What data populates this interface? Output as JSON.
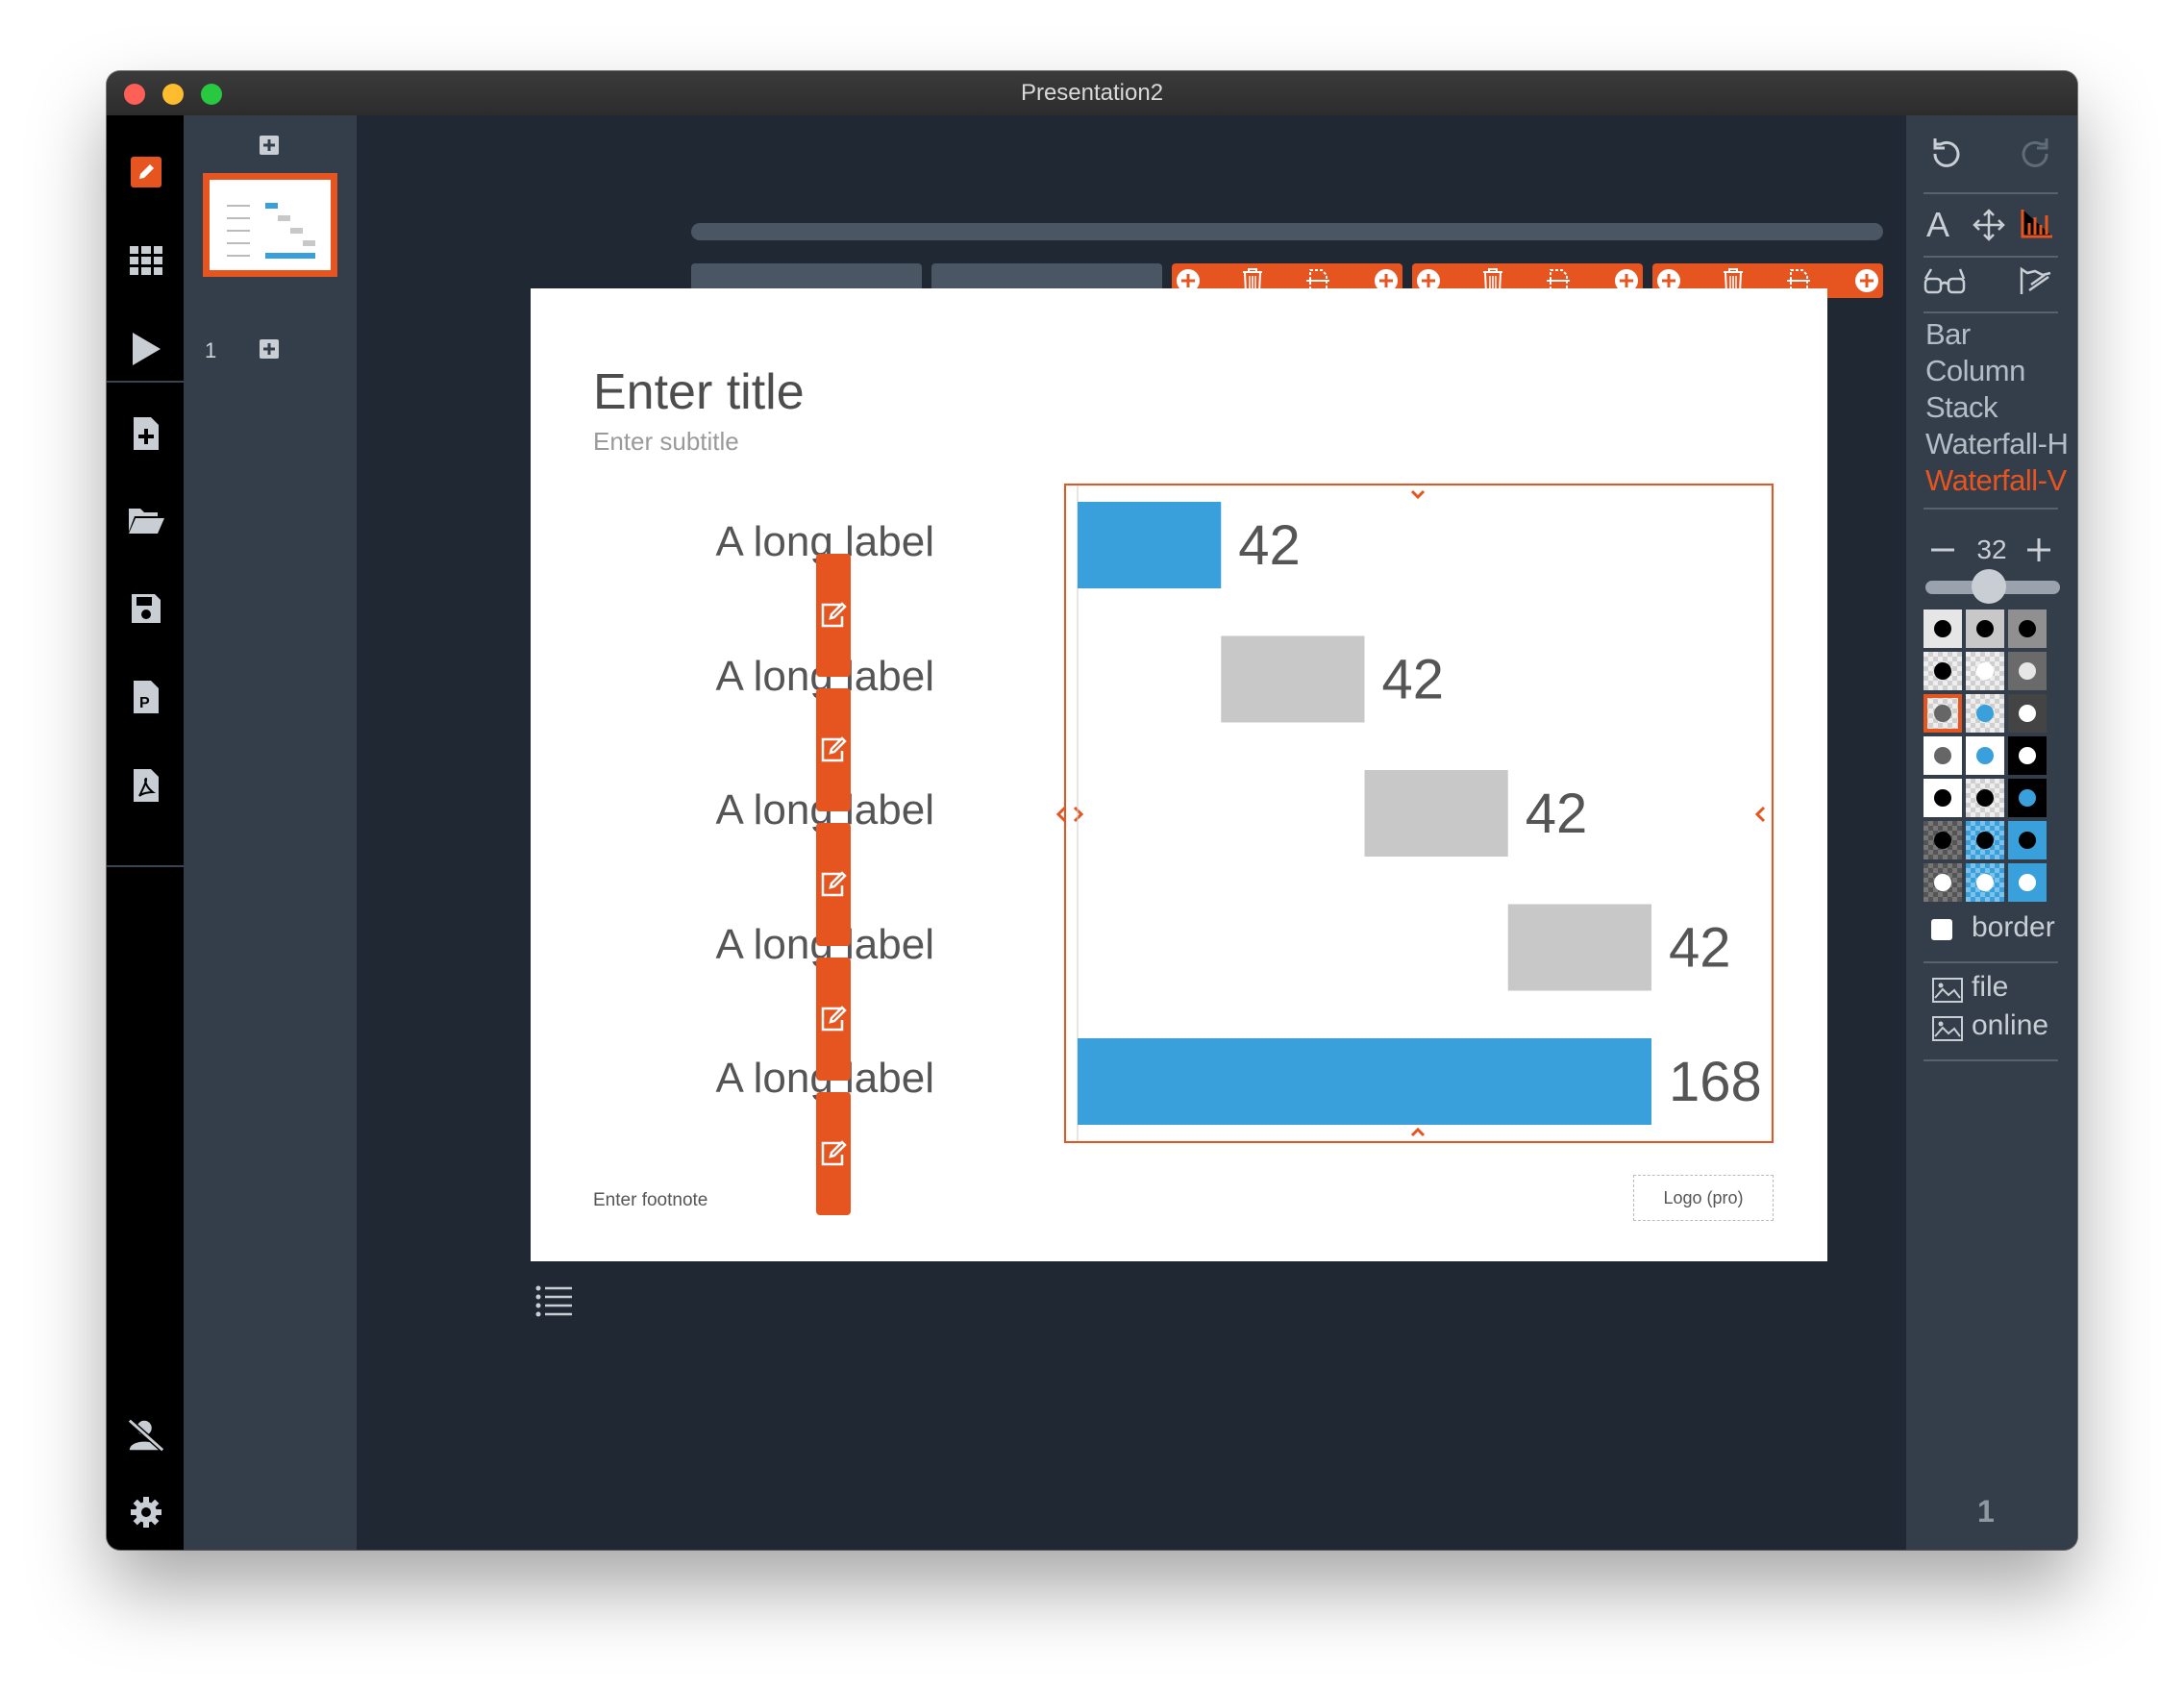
{
  "window": {
    "title": "Presentation2"
  },
  "thumbnails": {
    "page_number": "1"
  },
  "slide": {
    "title": "Enter title",
    "subtitle": "Enter subtitle",
    "footnote": "Enter footnote",
    "logo": "Logo (pro)"
  },
  "chart_data": {
    "type": "bar",
    "subtype": "waterfall-horizontal",
    "categories": [
      "A long label",
      "A long label",
      "A long label",
      "A long label",
      "A long label"
    ],
    "values": [
      42,
      42,
      42,
      42,
      168
    ],
    "offsets": [
      0,
      42,
      84,
      126,
      0
    ],
    "xlim": [
      0,
      168
    ],
    "colors": [
      "#39a0dc",
      "#c8c8c8",
      "#c8c8c8",
      "#c8c8c8",
      "#39a0dc"
    ],
    "data_labels": [
      "42",
      "42",
      "42",
      "42",
      "168"
    ],
    "grid": false,
    "legend": "none"
  },
  "right_panel": {
    "chart_types": [
      "Bar",
      "Column",
      "Stack",
      "Waterfall-H",
      "Waterfall-V"
    ],
    "selected_chart_type": "Waterfall-V",
    "font_size": "32",
    "border_label": "border",
    "file_label": "file",
    "online_label": "online",
    "page_indicator": "1"
  },
  "colors": {
    "accent": "#e65520",
    "bar_blue": "#39a0dc",
    "bar_gray": "#c8c8c8"
  }
}
